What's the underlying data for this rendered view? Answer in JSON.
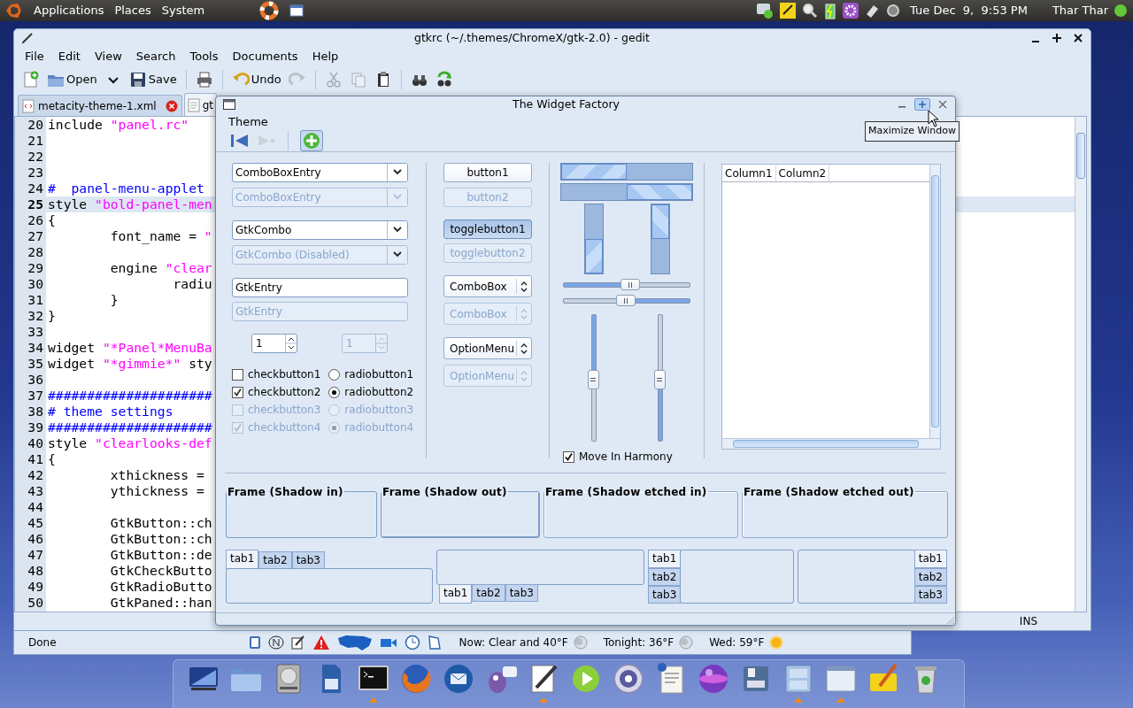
{
  "top_panel": {
    "menus": [
      "Applications",
      "Places",
      "System"
    ],
    "clock": "Tue Dec  9,  9:53 PM",
    "user": "Thar Thar"
  },
  "gedit": {
    "title": "gtkrc (~/.themes/ChromeX/gtk-2.0) - gedit",
    "menus": [
      "File",
      "Edit",
      "View",
      "Search",
      "Tools",
      "Documents",
      "Help"
    ],
    "toolbar": [
      {
        "kind": "new",
        "disabled": false
      },
      {
        "kind": "open",
        "label": "Open",
        "disabled": false
      },
      {
        "kind": "dropdown",
        "disabled": false
      },
      {
        "kind": "save",
        "label": "Save",
        "disabled": false
      },
      {
        "kind": "sep"
      },
      {
        "kind": "print",
        "disabled": false
      },
      {
        "kind": "sep"
      },
      {
        "kind": "undo",
        "label": "Undo",
        "disabled": false
      },
      {
        "kind": "redo",
        "disabled": true
      },
      {
        "kind": "sep"
      },
      {
        "kind": "cut",
        "disabled": true
      },
      {
        "kind": "copy",
        "disabled": true
      },
      {
        "kind": "paste",
        "disabled": false
      },
      {
        "kind": "sep"
      },
      {
        "kind": "find",
        "disabled": false
      },
      {
        "kind": "replace",
        "disabled": false
      }
    ],
    "tabs": [
      {
        "label": "metacity-theme-1.xml",
        "selected": false
      },
      {
        "label": "gt",
        "selected": true
      }
    ],
    "lines": [
      {
        "number": "20",
        "current": false,
        "segments": [
          {
            "kind": "plain",
            "text": "include "
          },
          {
            "kind": "string",
            "text": "\"panel.rc\""
          }
        ]
      },
      {
        "number": "21",
        "current": false
      },
      {
        "number": "22",
        "current": false
      },
      {
        "number": "23",
        "current": false
      },
      {
        "number": "24",
        "current": false,
        "segments": [
          {
            "kind": "comment",
            "text": "#  panel-menu-applet"
          }
        ]
      },
      {
        "number": "25",
        "current": true,
        "segments": [
          {
            "kind": "plain",
            "text": "style "
          },
          {
            "kind": "string",
            "text": "\"bold-panel-men"
          }
        ]
      },
      {
        "number": "26",
        "current": false,
        "segments": [
          {
            "kind": "plain",
            "text": "{"
          }
        ]
      },
      {
        "number": "27",
        "current": false,
        "segments": [
          {
            "kind": "plain",
            "text": "        font_name = "
          },
          {
            "kind": "string",
            "text": "\""
          }
        ]
      },
      {
        "number": "28",
        "current": false
      },
      {
        "number": "29",
        "current": false,
        "segments": [
          {
            "kind": "plain",
            "text": "        engine "
          },
          {
            "kind": "string",
            "text": "\"clear"
          }
        ]
      },
      {
        "number": "30",
        "current": false,
        "segments": [
          {
            "kind": "plain",
            "text": "                radiu"
          }
        ]
      },
      {
        "number": "31",
        "current": false,
        "segments": [
          {
            "kind": "plain",
            "text": "        }"
          }
        ]
      },
      {
        "number": "32",
        "current": false,
        "segments": [
          {
            "kind": "plain",
            "text": "}"
          }
        ]
      },
      {
        "number": "33",
        "current": false
      },
      {
        "number": "34",
        "current": false,
        "segments": [
          {
            "kind": "plain",
            "text": "widget "
          },
          {
            "kind": "string",
            "text": "\"*Panel*MenuBa"
          }
        ]
      },
      {
        "number": "35",
        "current": false,
        "segments": [
          {
            "kind": "plain",
            "text": "widget "
          },
          {
            "kind": "string",
            "text": "\"*gimmie*\""
          },
          {
            "kind": "plain",
            "text": " sty"
          }
        ]
      },
      {
        "number": "36",
        "current": false
      },
      {
        "number": "37",
        "current": false,
        "segments": [
          {
            "kind": "comment",
            "text": "#####################"
          }
        ]
      },
      {
        "number": "38",
        "current": false,
        "segments": [
          {
            "kind": "comment",
            "text": "# theme settings"
          }
        ]
      },
      {
        "number": "39",
        "current": false,
        "segments": [
          {
            "kind": "comment",
            "text": "#####################"
          }
        ]
      },
      {
        "number": "40",
        "current": false,
        "segments": [
          {
            "kind": "plain",
            "text": "style "
          },
          {
            "kind": "string",
            "text": "\"clearlooks-def"
          }
        ]
      },
      {
        "number": "41",
        "current": false,
        "segments": [
          {
            "kind": "plain",
            "text": "{"
          }
        ]
      },
      {
        "number": "42",
        "current": false,
        "segments": [
          {
            "kind": "plain",
            "text": "        xthickness ="
          }
        ]
      },
      {
        "number": "43",
        "current": false,
        "segments": [
          {
            "kind": "plain",
            "text": "        ythickness ="
          }
        ]
      },
      {
        "number": "44",
        "current": false
      },
      {
        "number": "45",
        "current": false,
        "segments": [
          {
            "kind": "plain",
            "text": "        GtkButton::ch"
          }
        ]
      },
      {
        "number": "46",
        "current": false,
        "segments": [
          {
            "kind": "plain",
            "text": "        GtkButton::ch"
          }
        ]
      },
      {
        "number": "47",
        "current": false,
        "segments": [
          {
            "kind": "plain",
            "text": "        GtkButton::de"
          }
        ]
      },
      {
        "number": "48",
        "current": false,
        "segments": [
          {
            "kind": "plain",
            "text": "        GtkCheckButto"
          }
        ]
      },
      {
        "number": "49",
        "current": false,
        "segments": [
          {
            "kind": "plain",
            "text": "        GtkRadioButto"
          }
        ]
      },
      {
        "number": "50",
        "current": false,
        "segments": [
          {
            "kind": "plain",
            "text": "        GtkPaned::han"
          }
        ]
      }
    ],
    "status": "INS"
  },
  "widget_factory": {
    "title": "The Widget Factory",
    "menus": [
      "Theme"
    ],
    "toolbar": [
      {
        "kind": "back",
        "disabled": false
      },
      {
        "kind": "forward",
        "disabled": true
      },
      {
        "kind": "add",
        "disabled": false
      }
    ],
    "fields": [
      {
        "kind": "combo",
        "value": "ComboBoxEntry",
        "disabled": false
      },
      {
        "kind": "combo",
        "value": "ComboBoxEntry",
        "disabled": true
      },
      {
        "kind": "combo",
        "value": "GtkCombo",
        "disabled": false
      },
      {
        "kind": "combo",
        "value": "GtkCombo (Disabled)",
        "disabled": true
      },
      {
        "kind": "entry",
        "value": "GtkEntry",
        "disabled": false
      },
      {
        "kind": "entry",
        "value": "GtkEntry",
        "disabled": true
      }
    ],
    "spins": [
      {
        "value": "1",
        "disabled": false
      },
      {
        "value": "1",
        "disabled": true
      }
    ],
    "checks": [
      {
        "label": "checkbutton1",
        "checked": false,
        "disabled": false
      },
      {
        "label": "checkbutton2",
        "checked": true,
        "disabled": false
      },
      {
        "label": "checkbutton3",
        "checked": false,
        "disabled": true
      },
      {
        "label": "checkbutton4",
        "checked": true,
        "disabled": true
      }
    ],
    "radios": [
      {
        "label": "radiobutton1",
        "selected": false,
        "disabled": false
      },
      {
        "label": "radiobutton2",
        "selected": true,
        "disabled": false
      },
      {
        "label": "radiobutton3",
        "selected": false,
        "disabled": true
      },
      {
        "label": "radiobutton4",
        "selected": true,
        "disabled": true
      }
    ],
    "buttons": [
      {
        "kind": "button",
        "label": "button1",
        "disabled": false,
        "pressed": false
      },
      {
        "kind": "button",
        "label": "button2",
        "disabled": true,
        "pressed": false
      },
      {
        "kind": "button",
        "label": "togglebutton1",
        "disabled": false,
        "pressed": true
      },
      {
        "kind": "button",
        "label": "togglebutton2",
        "disabled": true,
        "pressed": false
      },
      {
        "kind": "combo",
        "label": "ComboBox",
        "disabled": false,
        "pressed": false
      },
      {
        "kind": "combo",
        "label": "ComboBox",
        "disabled": true,
        "pressed": false
      },
      {
        "kind": "combo",
        "label": "OptionMenu",
        "disabled": false,
        "pressed": false
      },
      {
        "kind": "combo",
        "label": "OptionMenu",
        "disabled": true,
        "pressed": false
      }
    ],
    "progress_bars": [
      {
        "inverted": false,
        "level": 0.5
      },
      {
        "inverted": true,
        "level": 0.5
      }
    ],
    "vertical_progress_bars": [
      {
        "inverted": false,
        "level": 0.5
      },
      {
        "inverted": true,
        "level": 0.5
      }
    ],
    "scales": [
      {
        "inverted": false,
        "level": 0.53
      },
      {
        "inverted": true,
        "level": 0.49
      }
    ],
    "vertical_scales": [
      {
        "inverted": false,
        "level": 0.51
      },
      {
        "inverted": true,
        "level": 0.51
      }
    ],
    "harmony": {
      "label": "Move In Harmony",
      "checked": true
    },
    "tree": {
      "columns": [
        "Column1",
        "Column2"
      ]
    },
    "frames": [
      {
        "label": "Frame (Shadow in)",
        "kind": "in"
      },
      {
        "label": "Frame (Shadow out)",
        "kind": "out"
      },
      {
        "label": "Frame (Shadow etched in)",
        "kind": "etched_in"
      },
      {
        "label": "Frame (Shadow etched out)",
        "kind": "etched_out"
      }
    ],
    "notebooks": [
      {
        "kind": "top",
        "tabs": [
          {
            "label": "tab1",
            "selected": true
          },
          {
            "label": "tab2",
            "selected": false
          },
          {
            "label": "tab3",
            "selected": false
          }
        ]
      },
      {
        "kind": "bottom",
        "tabs": [
          {
            "label": "tab1",
            "selected": true
          },
          {
            "label": "tab2",
            "selected": false
          },
          {
            "label": "tab3",
            "selected": false
          }
        ]
      },
      {
        "kind": "left",
        "tabs": [
          {
            "label": "tab1",
            "selected": true
          },
          {
            "label": "tab2",
            "selected": false
          },
          {
            "label": "tab3",
            "selected": false
          }
        ]
      },
      {
        "kind": "right",
        "tabs": [
          {
            "label": "tab1",
            "selected": true
          },
          {
            "label": "tab2",
            "selected": false
          },
          {
            "label": "tab3",
            "selected": false
          }
        ]
      }
    ]
  },
  "tooltip": "Maximize Window",
  "browser_status": {
    "text": "Done",
    "weather": [
      {
        "label": "Now: Clear and 40°F",
        "kind": "moon"
      },
      {
        "label": "Tonight: 36°F",
        "kind": "moon"
      },
      {
        "label": "Wed: 59°F",
        "kind": "sun"
      }
    ]
  },
  "dock": [
    {
      "kind": "desktop",
      "running": false
    },
    {
      "kind": "folder",
      "running": false
    },
    {
      "kind": "drive",
      "running": false
    },
    {
      "kind": "card",
      "running": false
    },
    {
      "kind": "terminal",
      "running": true
    },
    {
      "kind": "browser",
      "running": false
    },
    {
      "kind": "mail",
      "running": false
    },
    {
      "kind": "chat",
      "running": false
    },
    {
      "kind": "editor",
      "running": true
    },
    {
      "kind": "play",
      "running": false
    },
    {
      "kind": "shutter",
      "running": false
    },
    {
      "kind": "document",
      "running": false
    },
    {
      "kind": "orb",
      "running": false
    },
    {
      "kind": "backup",
      "running": false
    },
    {
      "kind": "cabinet",
      "running": true
    },
    {
      "kind": "window",
      "running": true
    },
    {
      "kind": "notes",
      "running": false
    },
    {
      "kind": "trash",
      "running": false
    }
  ]
}
